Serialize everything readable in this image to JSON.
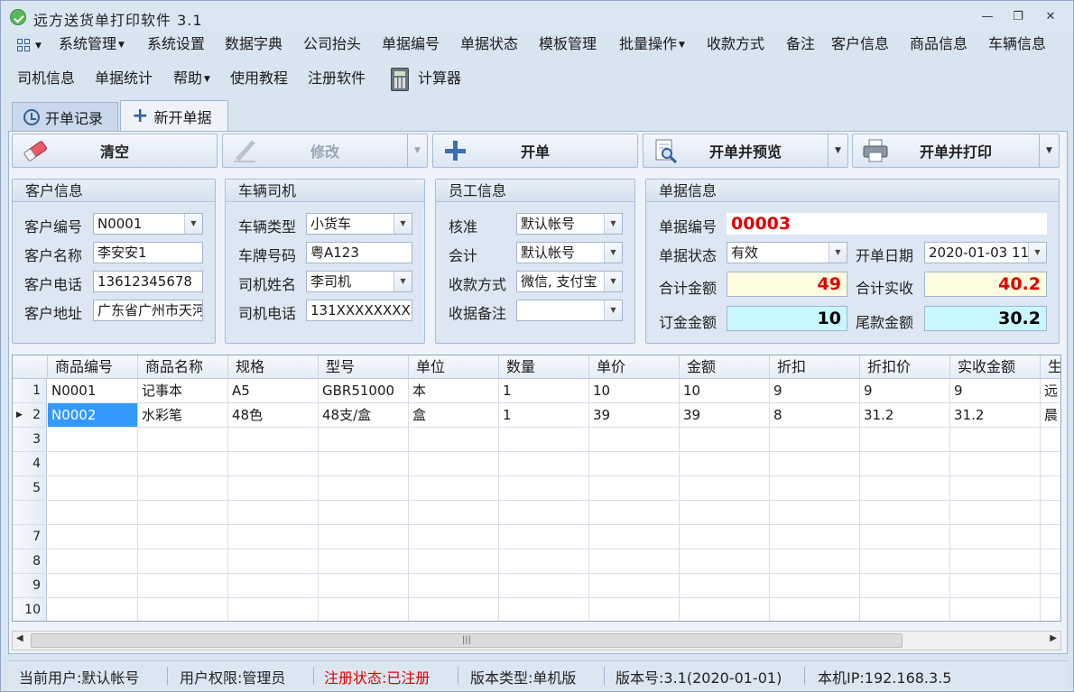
{
  "window": {
    "title": "远方送货单打印软件 3.1",
    "minimize": "—",
    "restore": "❐",
    "close": "✕"
  },
  "menu": {
    "items_row1": [
      {
        "label": "系统管理",
        "has_caret": true
      },
      {
        "label": "系统设置"
      },
      {
        "label": "数据字典"
      },
      {
        "label": "公司抬头"
      },
      {
        "label": "单据编号"
      },
      {
        "label": "单据状态"
      },
      {
        "label": "模板管理"
      },
      {
        "label": "批量操作",
        "has_caret": true
      },
      {
        "label": "收款方式"
      },
      {
        "label": "备注"
      },
      {
        "label": "客户信息"
      },
      {
        "label": "商品信息"
      },
      {
        "label": "车辆信息"
      }
    ],
    "items_row2": [
      {
        "label": "司机信息"
      },
      {
        "label": "单据统计"
      },
      {
        "label": "帮助",
        "has_caret": true
      },
      {
        "label": "使用教程"
      },
      {
        "label": "注册软件"
      },
      {
        "label": "计算器"
      }
    ]
  },
  "tabs": [
    {
      "label": "开单记录",
      "icon": "clock-icon"
    },
    {
      "label": "新开单据",
      "icon": "plus-icon",
      "active": true
    }
  ],
  "toolbar": {
    "clear": "清空",
    "edit": "修改",
    "create": "开单",
    "create_preview": "开单并预览",
    "create_print": "开单并打印"
  },
  "customer": {
    "title": "客户信息",
    "code_label": "客户编号",
    "code": "N0001",
    "name_label": "客户名称",
    "name": "李安安1",
    "phone_label": "客户电话",
    "phone": "13612345678",
    "address_label": "客户地址",
    "address": "广东省广州市天河区"
  },
  "vehicle": {
    "title": "车辆司机",
    "type_label": "车辆类型",
    "type": "小货车",
    "plate_label": "车牌号码",
    "plate": "粤A123",
    "driver_label": "司机姓名",
    "driver": "李司机",
    "driver_phone_label": "司机电话",
    "driver_phone": "131XXXXXXXX"
  },
  "staff": {
    "title": "员工信息",
    "approve_label": "核准",
    "approve": "默认帐号",
    "accountant_label": "会计",
    "accountant": "默认帐号",
    "payment_label": "收款方式",
    "payment": "微信, 支付宝",
    "note_label": "收据备注",
    "note": ""
  },
  "order": {
    "title": "单据信息",
    "number_label": "单据编号",
    "number": "00003",
    "status_label": "单据状态",
    "status": "有效",
    "date_label": "开单日期",
    "date": "2020-01-03 11",
    "total_label": "合计金额",
    "total": "49",
    "received_label": "合计实收",
    "received": "40.2",
    "deposit_label": "订金金额",
    "deposit": "10",
    "balance_label": "尾款金额",
    "balance": "30.2"
  },
  "colors": {
    "red": "#e00000",
    "total_bg": "#fffde0",
    "deposit_bg": "#c8f8ff"
  },
  "grid": {
    "columns": [
      "商品编号",
      "商品名称",
      "规格",
      "型号",
      "单位",
      "数量",
      "单价",
      "金额",
      "折扣",
      "折扣价",
      "实收金额",
      "生"
    ],
    "rows": [
      {
        "num": "1",
        "cells": [
          "N0001",
          "记事本",
          "A5",
          "GBR51000",
          "本",
          "1",
          "10",
          "10",
          "9",
          "9",
          "9",
          "远"
        ]
      },
      {
        "num": "2",
        "cells": [
          "N0002",
          "水彩笔",
          "48色",
          "48支/盒",
          "盒",
          "1",
          "39",
          "39",
          "8",
          "31.2",
          "31.2",
          "晨"
        ],
        "current": true
      },
      {
        "num": "3",
        "cells": [
          "",
          "",
          "",
          "",
          "",
          "",
          "",
          "",
          "",
          "",
          "",
          ""
        ]
      },
      {
        "num": "4",
        "cells": [
          "",
          "",
          "",
          "",
          "",
          "",
          "",
          "",
          "",
          "",
          "",
          ""
        ]
      },
      {
        "num": "5",
        "cells": [
          "",
          "",
          "",
          "",
          "",
          "",
          "",
          "",
          "",
          "",
          "",
          ""
        ]
      },
      {
        "num": "",
        "cells": [
          "",
          "",
          "",
          "",
          "",
          "",
          "",
          "",
          "",
          "",
          "",
          ""
        ]
      },
      {
        "num": "7",
        "cells": [
          "",
          "",
          "",
          "",
          "",
          "",
          "",
          "",
          "",
          "",
          "",
          ""
        ]
      },
      {
        "num": "8",
        "cells": [
          "",
          "",
          "",
          "",
          "",
          "",
          "",
          "",
          "",
          "",
          "",
          ""
        ]
      },
      {
        "num": "9",
        "cells": [
          "",
          "",
          "",
          "",
          "",
          "",
          "",
          "",
          "",
          "",
          "",
          ""
        ]
      },
      {
        "num": "10",
        "cells": [
          "",
          "",
          "",
          "",
          "",
          "",
          "",
          "",
          "",
          "",
          "",
          ""
        ]
      }
    ]
  },
  "status": {
    "user": "当前用户:默认帐号",
    "permission": "用户权限:管理员",
    "registration": "注册状态:已注册",
    "version_type": "版本类型:单机版",
    "version": "版本号:3.1(2020-01-01)",
    "ip": "本机IP:192.168.3.5"
  },
  "scroll": {
    "left": "◀",
    "right": "▶",
    "grip": "|||"
  }
}
